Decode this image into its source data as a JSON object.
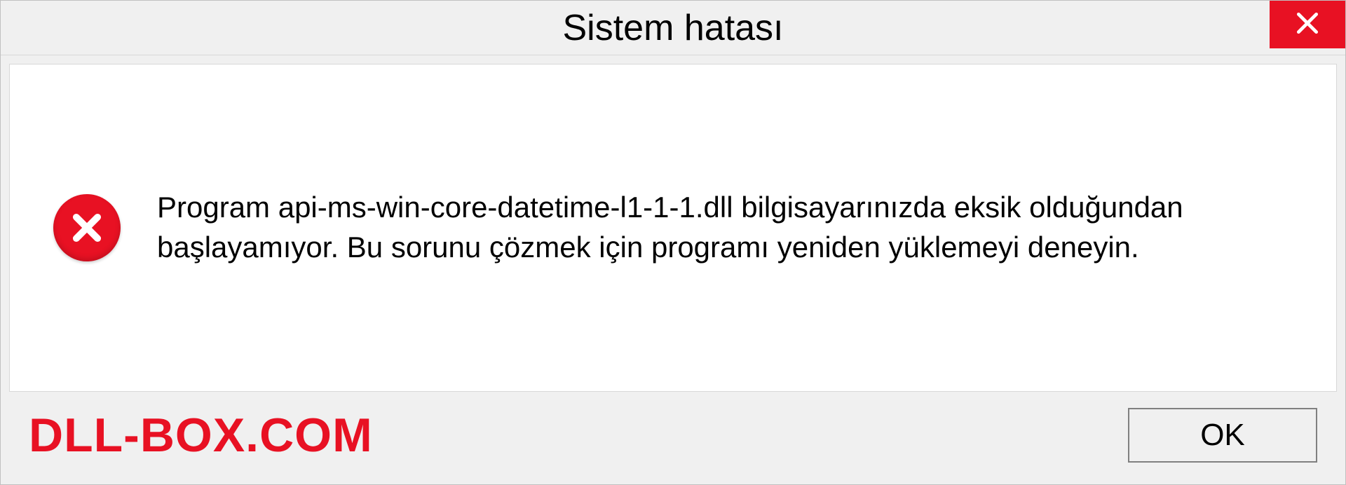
{
  "titlebar": {
    "title": "Sistem hatası"
  },
  "content": {
    "message": "Program api-ms-win-core-datetime-l1-1-1.dll bilgisayarınızda eksik olduğundan başlayamıyor. Bu sorunu çözmek için programı yeniden yüklemeyi deneyin."
  },
  "footer": {
    "watermark": "DLL-BOX.COM",
    "ok_label": "OK"
  }
}
